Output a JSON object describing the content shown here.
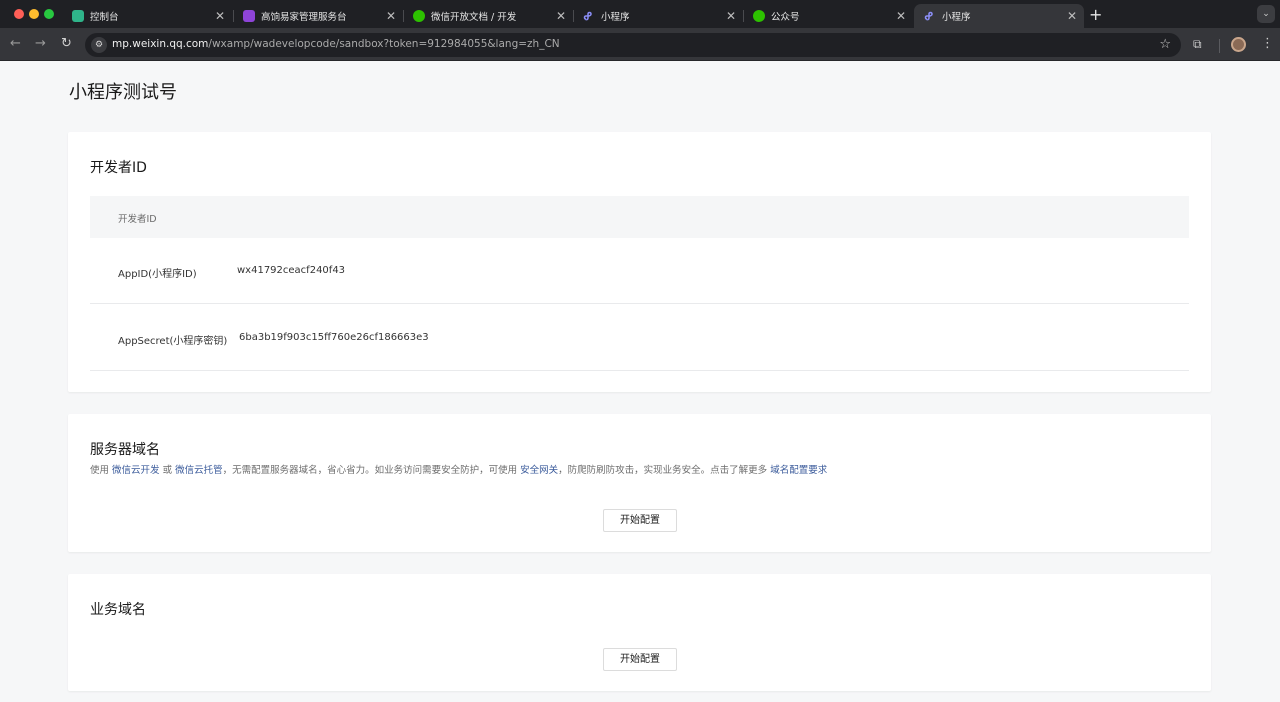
{
  "browser": {
    "tabs": [
      {
        "title": "控制台",
        "favicon": "shield-icon",
        "favicon_color": "#2fb48a",
        "active": false
      },
      {
        "title": "高饷易家管理服务台",
        "favicon": "purple-square-icon",
        "favicon_color": "#8e44d8",
        "active": false
      },
      {
        "title": "微信开放文档 / 开发",
        "favicon": "wechat-icon",
        "favicon_color": "#2dc100",
        "active": false
      },
      {
        "title": "小程序",
        "favicon": "miniprogram-icon",
        "favicon_color": "#6467f0",
        "active": false
      },
      {
        "title": "公众号",
        "favicon": "wechat-icon",
        "favicon_color": "#2dc100",
        "active": false
      },
      {
        "title": "小程序",
        "favicon": "miniprogram-icon",
        "favicon_color": "#6467f0",
        "active": true
      }
    ],
    "new_tab": "+",
    "url_host": "mp.weixin.qq.com",
    "url_path": "/wxamp/wadevelopcode/sandbox?token=912984055&lang=zh_CN"
  },
  "page": {
    "title": "小程序测试号",
    "developer": {
      "title": "开发者ID",
      "header": "开发者ID",
      "rows": [
        {
          "label": "AppID(小程序ID)",
          "value": "wx41792ceacf240f43"
        },
        {
          "label": "AppSecret(小程序密钥)",
          "value": "6ba3b19f903c15ff760e26cf186663e3"
        }
      ]
    },
    "server": {
      "title": "服务器域名",
      "desc_1": "使用 ",
      "link_1": "微信云开发",
      "desc_2": " 或 ",
      "link_2": "微信云托管",
      "desc_3": "，无需配置服务器域名，省心省力。如业务访问需要安全防护，可使用 ",
      "link_3": "安全网关",
      "desc_4": "，防爬防刷防攻击，实现业务安全。点击了解更多 ",
      "link_4": "域名配置要求",
      "button": "开始配置"
    },
    "business": {
      "title": "业务域名",
      "button": "开始配置"
    }
  },
  "colors": {
    "accent_link": "#3b5b9b",
    "chrome_dark": "#1f2024"
  }
}
